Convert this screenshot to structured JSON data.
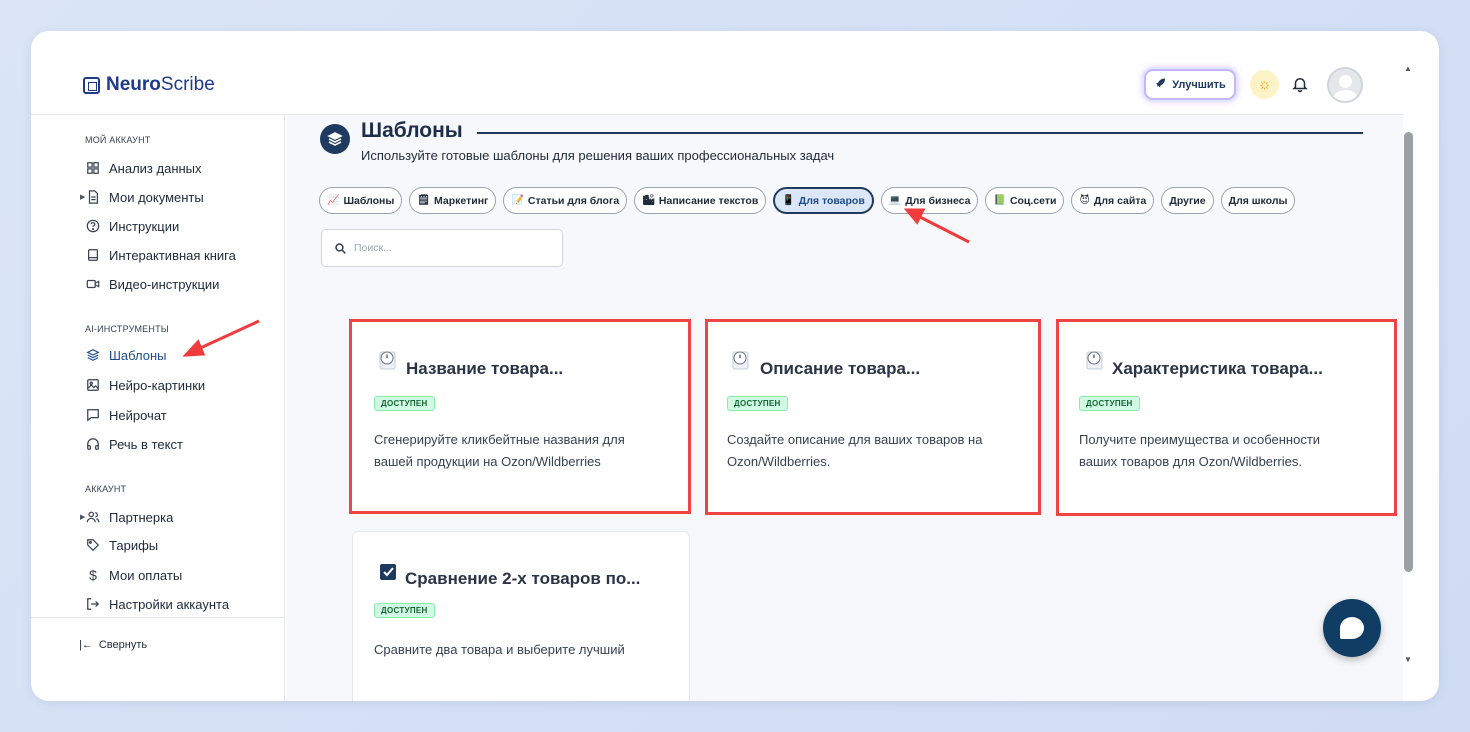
{
  "app": {
    "brand_bold": "Neuro",
    "brand_light": "Scribe"
  },
  "header": {
    "upgrade_label": "Улучшить"
  },
  "sidebar": {
    "sections": {
      "my_account": "МОЙ АККАУНТ",
      "ai_tools": "AI-ИНСТРУМЕНТЫ",
      "account": "АККАУНТ"
    },
    "items": [
      {
        "label": "Анализ данных"
      },
      {
        "label": "Мои документы"
      },
      {
        "label": "Инструкции"
      },
      {
        "label": "Интерактивная книга"
      },
      {
        "label": "Видео-инструкции"
      },
      {
        "label": "Шаблоны"
      },
      {
        "label": "Нейро-картинки"
      },
      {
        "label": "Нейрочат"
      },
      {
        "label": "Речь в текст"
      },
      {
        "label": "Партнерка"
      },
      {
        "label": "Тарифы"
      },
      {
        "label": "Мои оплаты"
      },
      {
        "label": "Настройки аккаунта"
      }
    ],
    "collapse_label": "Свернуть"
  },
  "main": {
    "title": "Шаблоны",
    "subtitle": "Используйте готовые шаблоны для решения ваших профессиональных задач",
    "tabs": [
      {
        "label": "Шаблоны",
        "icon": "📈"
      },
      {
        "label": "Маркетинг",
        "icon": "🗒"
      },
      {
        "label": "Статьи для блога",
        "icon": "📝"
      },
      {
        "label": "Написание текстов",
        "icon": "🏙"
      },
      {
        "label": "Для товаров",
        "icon": "📱"
      },
      {
        "label": "Для бизнеса",
        "icon": "💻"
      },
      {
        "label": "Соц.сети",
        "icon": "📗"
      },
      {
        "label": "Для сайта",
        "icon": "😈"
      },
      {
        "label": "Другие",
        "icon": ""
      },
      {
        "label": "Для школы",
        "icon": ""
      }
    ],
    "search_placeholder": "Поиск...",
    "cards": [
      {
        "title": "Название товара...",
        "badge": "ДОСТУПЕН",
        "desc1": "Сгенерируйте кликбейтные названия для",
        "desc2": "вашей продукции на Ozon/Wildberries"
      },
      {
        "title": "Описание товара...",
        "badge": "ДОСТУПЕН",
        "desc1": "Создайте описание для ваших товаров на",
        "desc2": "Ozon/Wildberries."
      },
      {
        "title": "Характеристика товара...",
        "badge": "ДОСТУПЕН",
        "desc1": "Получите преимущества и особенности",
        "desc2": "ваших товаров для Ozon/Wildberries."
      },
      {
        "title": "Сравнение 2-х товаров по...",
        "badge": "ДОСТУПЕН",
        "desc1": "Сравните два товара и выберите лучший",
        "desc2": ""
      }
    ]
  },
  "colors": {
    "accent": "#1e3a5f",
    "highlight": "#ef4444",
    "badge_bg": "#d1fae5"
  }
}
